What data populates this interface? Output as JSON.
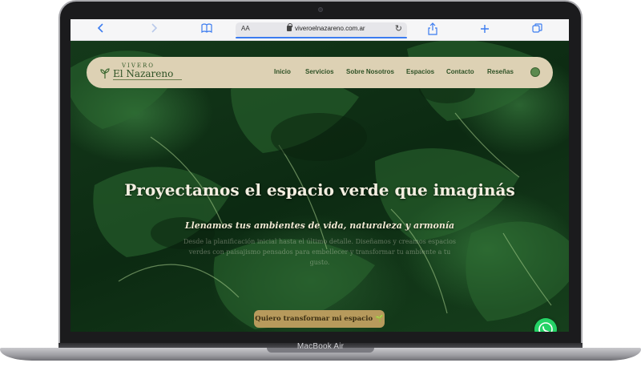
{
  "browser": {
    "aa_label": "AA",
    "url": "viveroelnazareno.com.ar"
  },
  "site": {
    "logo_top": "VIVERO",
    "logo_name": "El Nazareno",
    "nav": [
      "Inicio",
      "Servicios",
      "Sobre Nosotros",
      "Espacios",
      "Contacto",
      "Reseñas"
    ],
    "headline": "Proyectamos el espacio verde que imaginás",
    "subheadline": "Llenamos tus ambientes de vida, naturaleza y armonía",
    "body": "Desde la planificación inicial hasta el último detalle. Diseñamos y creamos espacios verdes con paisajismo pensados para embellecer y transformar tu ambiente a tu gusto.",
    "cta": "Quiero transformar mi espacio 🌱"
  },
  "device": {
    "label": "MacBook Air"
  },
  "colors": {
    "nav_bg": "#ddd1b4",
    "brand_green": "#2f5226",
    "cta_bg": "#b79a5c",
    "whatsapp": "#25d366",
    "safari_blue": "#3b7cf0"
  },
  "icons": [
    "back-icon",
    "forward-icon",
    "bookmarks-icon",
    "lock-icon",
    "reload-icon",
    "share-icon",
    "new-tab-icon",
    "tabs-icon",
    "leaf-logo-icon",
    "whatsapp-icon"
  ]
}
